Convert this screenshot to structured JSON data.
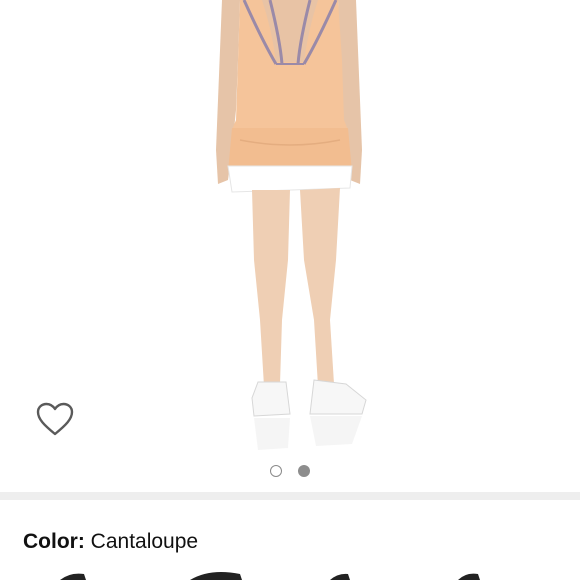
{
  "product": {
    "image_alt": "Tennis dress back view",
    "carousel": {
      "total": 2,
      "active_index": 1
    }
  },
  "wishlist": {
    "icon": "heart-outline-icon"
  },
  "color_selector": {
    "label": "Color:",
    "value": "Cantaloupe"
  },
  "colors": {
    "dress": "#f5c49a",
    "divider": "#eeeeee",
    "dot_active": "#8d8d8d"
  }
}
